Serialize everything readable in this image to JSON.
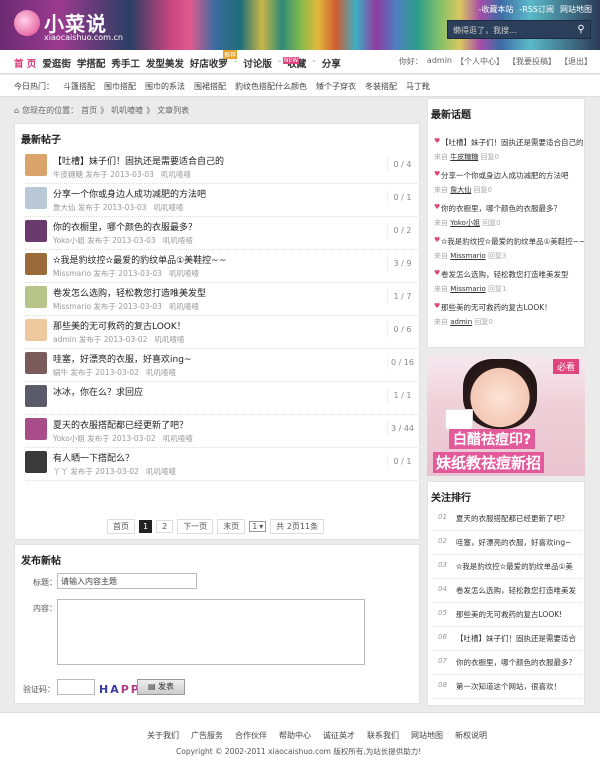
{
  "header": {
    "logo_text": "小菜说",
    "logo_domain": "xiaocaishuo.com.cn",
    "top_links": [
      "-收藏本站",
      "-RSS订阅",
      "网站地图"
    ],
    "search_placeholder": "懒得逛了，我搜…"
  },
  "nav": {
    "items": [
      "首 页",
      "爱逛街",
      "学搭配",
      "秀手工",
      "发型美发",
      "好店收罗",
      "讨论版",
      "收藏",
      "分享"
    ],
    "badge_tg": "推荐",
    "badge_new": "NEW",
    "user_prefix": "你好：",
    "user_name": "admin",
    "user_links": [
      "【个人中心】",
      "【我要投稿】",
      "【退出】"
    ]
  },
  "hot": {
    "label": "今日热门：",
    "items": [
      "斗篷搭配",
      "围巾搭配",
      "围巾的系法",
      "围裙搭配",
      "豹纹色搭配什么颜色",
      "矮个子穿衣",
      "冬装搭配",
      "马丁靴"
    ]
  },
  "breadcrumb": [
    "您现在的位置：",
    "首页",
    "》",
    "叽叽喳喳",
    "》",
    "文章列表"
  ],
  "posts_title": "最新帖子",
  "posts": [
    {
      "title": "【吐槽】妹子们！固执还是需要适合自己的",
      "author": "牛皮糖糖",
      "date": "发布于 2013-03-03",
      "cat": "叽叽喳喳",
      "count": "0 / 4",
      "color": "#d9a36b"
    },
    {
      "title": "分享一个你或身边人成功减肥的方法吧",
      "author": "詹大仙",
      "date": "发布于 2013-03-03",
      "cat": "叽叽喳喳",
      "count": "0 / 1",
      "color": "#b9c7d6"
    },
    {
      "title": "你的衣橱里，哪个颜色的衣服最多？",
      "author": "Yoko小姐",
      "date": "发布于 2013-03-03",
      "cat": "叽叽喳喳",
      "count": "0 / 2",
      "color": "#6a3a6e"
    },
    {
      "title": "✫我是豹纹控✫最爱的豹纹单品①美鞋控~~",
      "author": "Missmario",
      "date": "发布于 2013-03-03",
      "cat": "叽叽喳喳",
      "count": "3 / 9",
      "color": "#9a6a3a"
    },
    {
      "title": "卷发怎么选购，轻松教您打造唯美发型",
      "author": "Missmario",
      "date": "发布于 2013-03-03",
      "cat": "叽叽喳喳",
      "count": "1 / 7",
      "color": "#b7c48a"
    },
    {
      "title": "那些美的无可救药的复古LOOK！",
      "author": "admin",
      "date": "发布于 2013-03-02",
      "cat": "叽叽喳喳",
      "count": "0 / 6",
      "color": "#f0c8a0"
    },
    {
      "title": "哇塞，好漂亮的衣服，好喜欢ing~",
      "author": "蜗牛",
      "date": "发布于 2013-03-02",
      "cat": "叽叽喳喳",
      "count": "0 / 16",
      "color": "#7a5a5a"
    },
    {
      "title": "冰冰，你在么？求回应",
      "author": "",
      "date": "",
      "cat": "",
      "count": "1 / 1",
      "color": "#5a5a6a"
    },
    {
      "title": "夏天的衣服搭配都已经更新了吧？",
      "author": "Yoko小姐",
      "date": "发布于 2013-03-02",
      "cat": "叽叽喳喳",
      "count": "3 / 44",
      "color": "#a84d8a"
    },
    {
      "title": "有人晒一下搭配么？",
      "author": "丫丫",
      "date": "发布于 2013-03-02",
      "cat": "叽叽喳喳",
      "count": "0 / 1",
      "color": "#3a3a3a"
    }
  ],
  "pager": {
    "first": "首页",
    "p1": "1",
    "p2": "2",
    "next": "下一页",
    "last": "末页",
    "sel": "1",
    "total": "共 2页11条"
  },
  "publish": {
    "title": "发布新帖",
    "title_label": "标题：",
    "title_placeholder": "请输入内容主题",
    "content_label": "内容：",
    "captcha_label": "验证码：",
    "captcha_text": "HAPP",
    "submit": "发表"
  },
  "latest_title": "最新话题",
  "latest": [
    {
      "title": "【吐槽】妹子们！固执还是需要适合自己的",
      "prefix": "来自",
      "user": "牛皮糖糖",
      "reply": "回复0"
    },
    {
      "title": "分享一个你或身边人成功减肥的方法吧",
      "prefix": "来自",
      "user": "詹大仙",
      "reply": "回复0"
    },
    {
      "title": "你的衣橱里，哪个颜色的衣服最多？",
      "prefix": "来自",
      "user": "Yoko小姐",
      "reply": "回复0"
    },
    {
      "title": "✫我是豹纹控✫最爱的豹纹单品①美鞋控~~",
      "prefix": "来自",
      "user": "Missmario",
      "reply": "回复3"
    },
    {
      "title": "卷发怎么选购，轻松教您打造唯美发型",
      "prefix": "来自",
      "user": "Missmario",
      "reply": "回复1"
    },
    {
      "title": "那些美的无可救药的复古LOOK！",
      "prefix": "来自",
      "user": "admin",
      "reply": "回复0"
    }
  ],
  "ad": {
    "tag": "必看",
    "line1": "白醋祛痘印?",
    "line2": "妹纸教祛痘新招"
  },
  "rank_title": "关注排行",
  "rank": [
    {
      "n": "01",
      "title": "夏天的衣服搭配都已经更新了吧?"
    },
    {
      "n": "02",
      "title": "哇塞，好漂亮的衣服，好喜欢ing~"
    },
    {
      "n": "03",
      "title": "✫我是豹纹控✫最爱的豹纹单品①美"
    },
    {
      "n": "04",
      "title": "卷发怎么选购，轻松教您打造唯美发"
    },
    {
      "n": "05",
      "title": "那些美的无可救药的复古LOOK!"
    },
    {
      "n": "06",
      "title": "【吐槽】妹子们！固执还是需要适合"
    },
    {
      "n": "07",
      "title": "你的衣橱里，哪个颜色的衣服最多?"
    },
    {
      "n": "08",
      "title": "第一次知道这个网站，很喜欢！"
    }
  ],
  "footer": {
    "links": [
      "关于我们",
      "广告服务",
      "合作伙伴",
      "帮助中心",
      "诚征英才",
      "联系我们",
      "网站地图",
      "新权说明"
    ],
    "copyright": "Copyright © 2002-2011 xiaocaishuo.com 版权所有,为站长提供助力!"
  }
}
